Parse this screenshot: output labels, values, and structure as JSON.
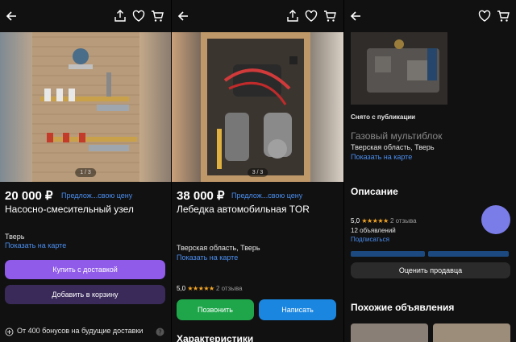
{
  "panel1": {
    "photo_counter": "1 / 3",
    "price": "20 000 ₽",
    "offer_link": "Предлож...свою цену",
    "title": "Насосно-смесительный узел",
    "city": "Тверь",
    "map_link": "Показать на карте",
    "buy_delivery": "Купить с доставкой",
    "add_to_cart": "Добавить в корзину",
    "bonus_text": "От 400 бонусов на будущие доставки",
    "colors": {
      "buy": "#8f5be8",
      "cart": "#3a2a5a"
    }
  },
  "panel2": {
    "photo_counter": "3 / 3",
    "price": "38 000 ₽",
    "offer_link": "Предлож...свою цену",
    "title": "Лебедка автомобильная TOR",
    "location": "Тверская область, Тверь",
    "map_link": "Показать на карте",
    "rating": "5,0",
    "stars": "★★★★★",
    "reviews": "2 отзыва",
    "call": "Позвонить",
    "write": "Написать",
    "specs_heading": "Характеристики",
    "colors": {
      "call": "#1fa64a",
      "write": "#1a86e0"
    }
  },
  "panel3": {
    "removed": "Снято с публикации",
    "title": "Газовый мультиблок",
    "location": "Тверская область, Тверь",
    "map_link": "Показать на карте",
    "description_heading": "Описание",
    "rating": "5,0",
    "stars": "★★★★★",
    "reviews": "2 отзыва",
    "listings": "12 объявлений",
    "subscribe": "Подписаться",
    "rate_seller": "Оценить продавца",
    "similar_heading": "Похожие объявления",
    "colors": {
      "avatar": "#7a7ce8"
    }
  }
}
